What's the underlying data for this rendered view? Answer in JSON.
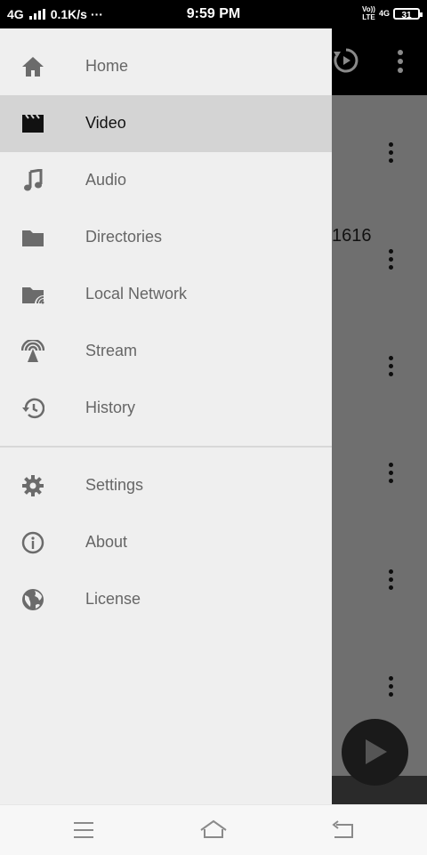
{
  "status_bar": {
    "network_type": "4G",
    "data_speed": "0.1K/s",
    "more_indicator": "···",
    "time": "9:59 PM",
    "volte_line1": "Vo))",
    "volte_line2": "LTE",
    "network_right": "4G",
    "battery_level": "31"
  },
  "background_app": {
    "partial_text": "1616"
  },
  "drawer": {
    "selected": "Video",
    "primary_items": [
      {
        "label": "Home",
        "icon": "home-icon"
      },
      {
        "label": "Video",
        "icon": "movie-clapper-icon"
      },
      {
        "label": "Audio",
        "icon": "music-note-icon"
      },
      {
        "label": "Directories",
        "icon": "folder-icon"
      },
      {
        "label": "Local Network",
        "icon": "network-folder-icon"
      },
      {
        "label": "Stream",
        "icon": "antenna-stream-icon"
      },
      {
        "label": "History",
        "icon": "history-icon"
      }
    ],
    "secondary_items": [
      {
        "label": "Settings",
        "icon": "gear-icon"
      },
      {
        "label": "About",
        "icon": "info-icon"
      },
      {
        "label": "License",
        "icon": "globe-icon"
      }
    ]
  },
  "colors": {
    "drawer_bg": "#efefef",
    "selected_bg": "#d4d4d4",
    "icon_color": "#6b6b6b",
    "scrim": "#6f6f6f"
  }
}
